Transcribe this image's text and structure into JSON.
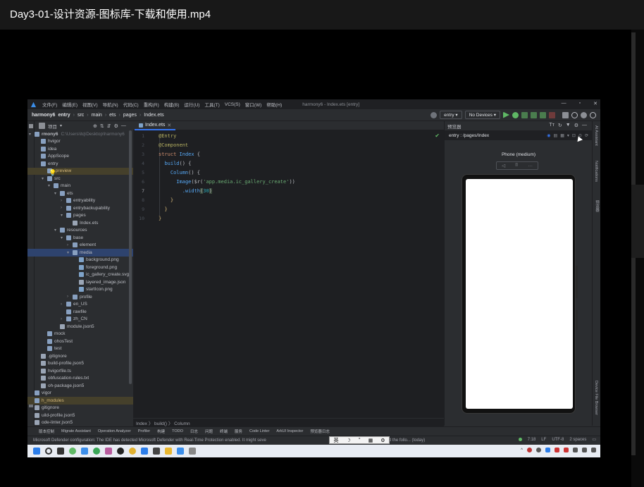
{
  "player": {
    "title": "Day3-01-设计资源-图标库-下载和使用.mp4"
  },
  "menubar": {
    "items": [
      "文件(F)",
      "编辑(E)",
      "视图(V)",
      "导航(N)",
      "代码(C)",
      "重构(R)",
      "构建(B)",
      "运行(U)",
      "工具(T)",
      "VCS(S)",
      "窗口(W)",
      "帮助(H)"
    ],
    "window_title": "harmony6 - Index.ets [entry]"
  },
  "navbar": {
    "crumbs": [
      "harmony6",
      "entry",
      "src",
      "main",
      "ets",
      "pages",
      "Index.ets"
    ],
    "run_config": "entry",
    "devices": "No Devices"
  },
  "project": {
    "header": "项目"
  },
  "tree": [
    {
      "label": "rmony6",
      "note": "C:\\Users\\itq\\Desktop\\harmony6",
      "depth": 0,
      "icon": "folder",
      "arrow": "▾"
    },
    {
      "label": "hvigor",
      "depth": 1,
      "icon": "folder",
      "arrow": ""
    },
    {
      "label": "idea",
      "depth": 1,
      "icon": "folder",
      "arrow": ""
    },
    {
      "label": "AppScope",
      "depth": 1,
      "icon": "folder",
      "arrow": ""
    },
    {
      "label": "entry",
      "depth": 1,
      "icon": "folder",
      "arrow": ""
    },
    {
      "label": ".preview",
      "depth": 2,
      "icon": "folder",
      "arrow": "",
      "highlight": true
    },
    {
      "label": "src",
      "depth": 2,
      "icon": "folder",
      "arrow": "▾"
    },
    {
      "label": "main",
      "depth": 3,
      "icon": "folder",
      "arrow": "▾"
    },
    {
      "label": "ets",
      "depth": 4,
      "icon": "folder",
      "arrow": "▾"
    },
    {
      "label": "entryability",
      "depth": 5,
      "icon": "folder",
      "arrow": "›"
    },
    {
      "label": "entrybackupability",
      "depth": 5,
      "icon": "folder",
      "arrow": "›"
    },
    {
      "label": "pages",
      "depth": 5,
      "icon": "folder",
      "arrow": "▾"
    },
    {
      "label": "Index.ets",
      "depth": 6,
      "icon": "file",
      "arrow": ""
    },
    {
      "label": "resources",
      "depth": 4,
      "icon": "folder",
      "arrow": "▾"
    },
    {
      "label": "base",
      "depth": 5,
      "icon": "folder",
      "arrow": "▾"
    },
    {
      "label": "element",
      "depth": 6,
      "icon": "folder",
      "arrow": "›"
    },
    {
      "label": "media",
      "depth": 6,
      "icon": "folder",
      "arrow": "▾",
      "selected": true
    },
    {
      "label": "background.png",
      "depth": 7,
      "icon": "image",
      "arrow": ""
    },
    {
      "label": "foreground.png",
      "depth": 7,
      "icon": "image",
      "arrow": ""
    },
    {
      "label": "ic_gallery_create.svg",
      "depth": 7,
      "icon": "image",
      "arrow": ""
    },
    {
      "label": "layered_image.json",
      "depth": 7,
      "icon": "file",
      "arrow": ""
    },
    {
      "label": "startIcon.png",
      "depth": 7,
      "icon": "image",
      "arrow": ""
    },
    {
      "label": "profile",
      "depth": 6,
      "icon": "folder",
      "arrow": "›"
    },
    {
      "label": "en_US",
      "depth": 5,
      "icon": "folder",
      "arrow": "›"
    },
    {
      "label": "rawfile",
      "depth": 5,
      "icon": "folder",
      "arrow": ""
    },
    {
      "label": "zh_CN",
      "depth": 5,
      "icon": "folder",
      "arrow": "›"
    },
    {
      "label": "module.json5",
      "depth": 4,
      "icon": "file",
      "arrow": ""
    },
    {
      "label": "mock",
      "depth": 2,
      "icon": "folder",
      "arrow": ""
    },
    {
      "label": "ohosTest",
      "depth": 2,
      "icon": "folder",
      "arrow": ""
    },
    {
      "label": "test",
      "depth": 2,
      "icon": "folder",
      "arrow": ""
    },
    {
      "label": ".gitignore",
      "depth": 1,
      "icon": "file",
      "arrow": ""
    },
    {
      "label": "build-profile.json5",
      "depth": 1,
      "icon": "file",
      "arrow": ""
    },
    {
      "label": "hvigorfile.ts",
      "depth": 1,
      "icon": "file",
      "arrow": ""
    },
    {
      "label": "obfuscation-rules.txt",
      "depth": 1,
      "icon": "file",
      "arrow": ""
    },
    {
      "label": "oh-package.json5",
      "depth": 1,
      "icon": "file",
      "arrow": ""
    },
    {
      "label": "vigor",
      "depth": 0,
      "icon": "folder",
      "arrow": ""
    },
    {
      "label": "h_modules",
      "depth": 0,
      "icon": "folder",
      "arrow": "",
      "highlight": true
    },
    {
      "label": "gitignore",
      "depth": 0,
      "icon": "file",
      "arrow": ""
    },
    {
      "label": "uild-profile.json5",
      "depth": 0,
      "icon": "file",
      "arrow": ""
    },
    {
      "label": "ode-linter.json5",
      "depth": 0,
      "icon": "file",
      "arrow": ""
    }
  ],
  "editor": {
    "tab": "Index.ets",
    "lines": [
      "1",
      "2",
      "3",
      "4",
      "5",
      "6",
      "7",
      "8",
      "9",
      "10"
    ],
    "code": {
      "l1": "@Entry",
      "l2": "@Component",
      "l3_kw": "struct",
      "l3_ty": "Index",
      "l3_br": " {",
      "l4_fn": "build",
      "l4_br": "() {",
      "l5_fn": "Column",
      "l5_br": "() {",
      "l6_fn": "Image",
      "l6_a": "($r(",
      "l6_st": "'app.media.ic_gallery_create'",
      "l6_b": "))",
      "l7_fn": ".width",
      "l7_a": "(",
      "l7_nm": "30",
      "l7_b": ")",
      "l8": "}",
      "l9": "}",
      "l10": "}"
    },
    "breadcrumb": "Index 〉 build() 〉 Column"
  },
  "preview": {
    "header": "预览器",
    "path": "entry : /pages/Index",
    "device": "Phone (medium)"
  },
  "rightstrip": {
    "labels": [
      "AI Assistant",
      "Notifications",
      "预览器",
      "Device File Browser"
    ]
  },
  "bottomtabs": [
    "版本控制",
    "Migrate Assistant",
    "Operation Analyzer",
    "Profiler",
    "构建",
    "TODO",
    "日志",
    "问题",
    "终端",
    "服务",
    "Code Linter",
    "ArkUI Inspector",
    "预览器日志"
  ],
  "statusbar": {
    "message": "Microsoft Defender configuration: The IDE has detected Microsoft Defender with Real-Time Protection enabled. It might seve",
    "message_tail": "ce. It is recommended to add the follo... (today)",
    "ime": [
      "英",
      "☽",
      "°",
      "▦",
      "⚙"
    ],
    "position": "7:18",
    "line_sep": "LF",
    "encoding": "UTF-8",
    "indent": "2 spaces"
  }
}
